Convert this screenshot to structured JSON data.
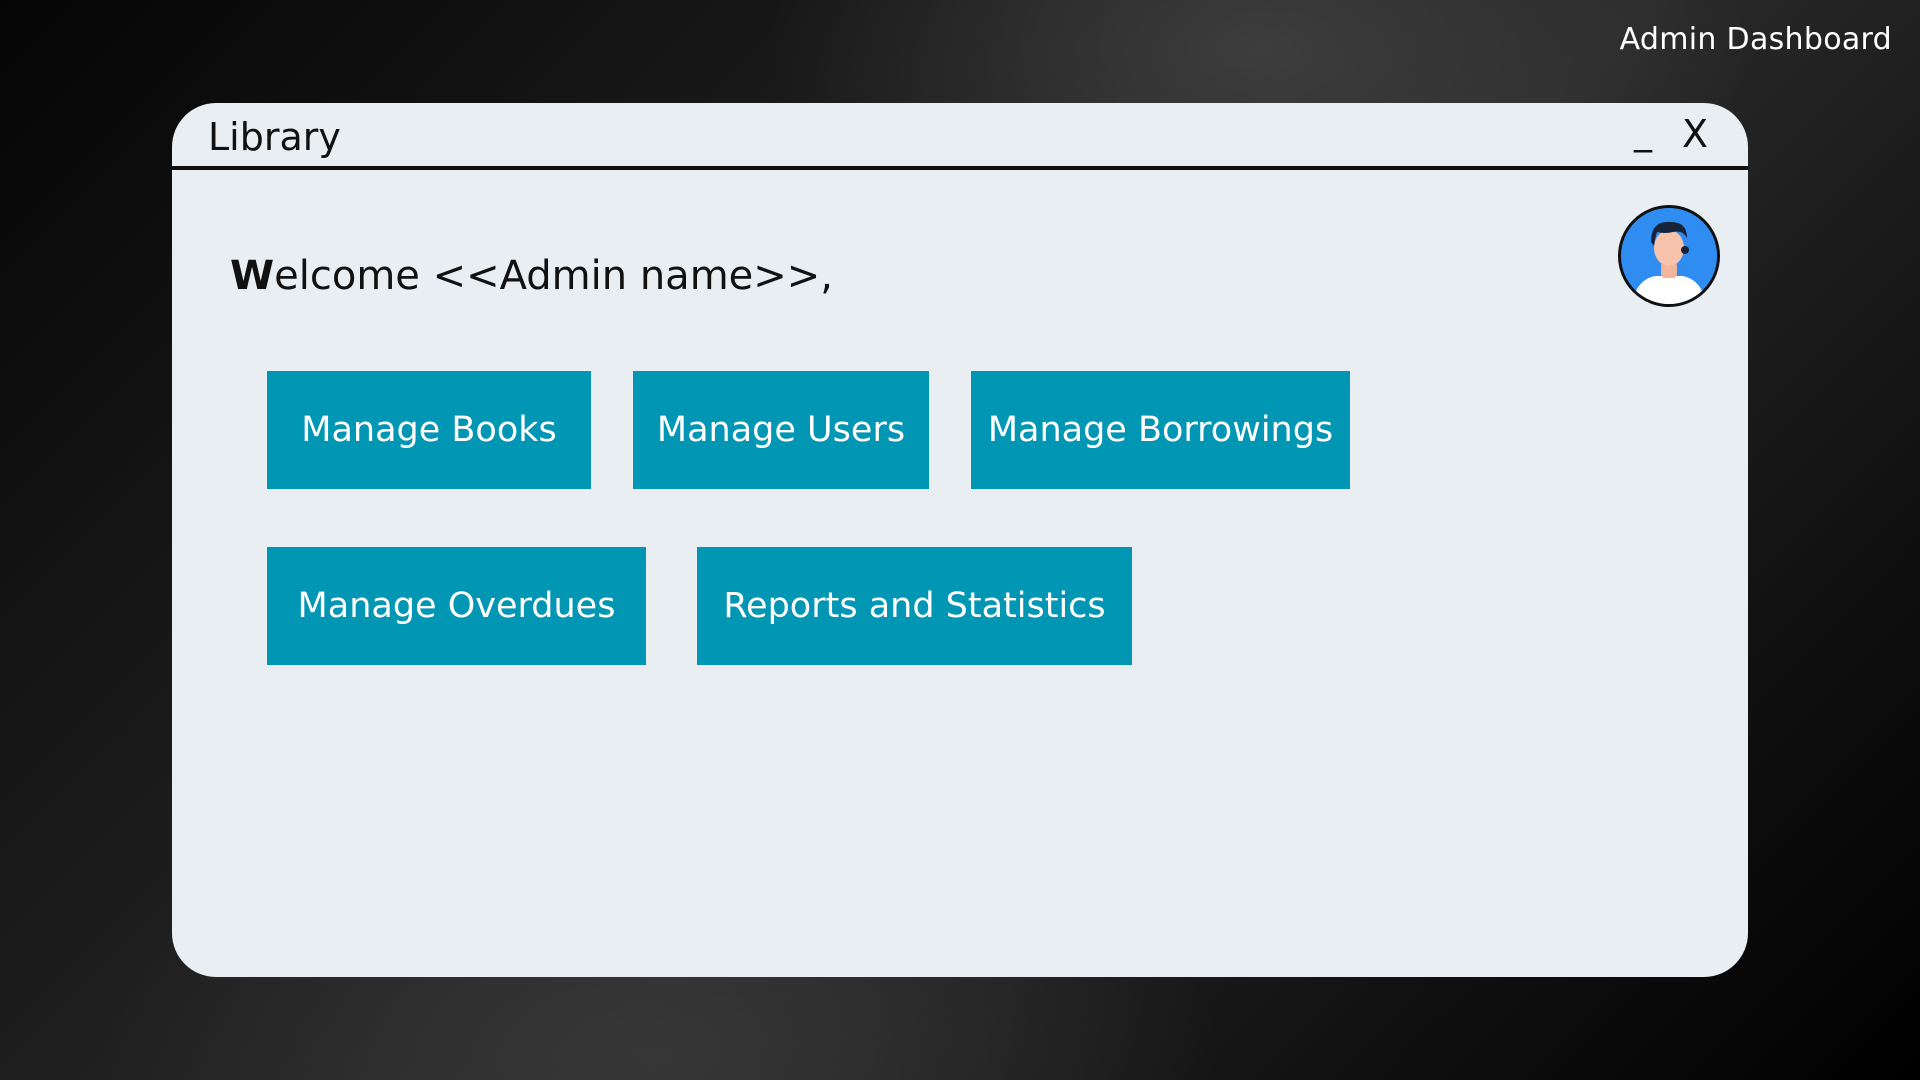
{
  "page": {
    "corner_title": "Admin Dashboard"
  },
  "window": {
    "title": "Library",
    "minimize_label": "_",
    "close_label": "X"
  },
  "main": {
    "welcome_initial": "W",
    "welcome_rest": "elcome <<Admin name>>,",
    "avatar_icon": "user-avatar-icon",
    "buttons": [
      {
        "label": "Manage Books"
      },
      {
        "label": "Manage Users"
      },
      {
        "label": "Manage Borrowings"
      },
      {
        "label": "Manage Overdues"
      },
      {
        "label": "Reports and Statistics"
      }
    ]
  },
  "colors": {
    "button_bg": "#0096b4",
    "window_bg": "#e8eef2",
    "avatar_bg": "#2f8cf0"
  }
}
